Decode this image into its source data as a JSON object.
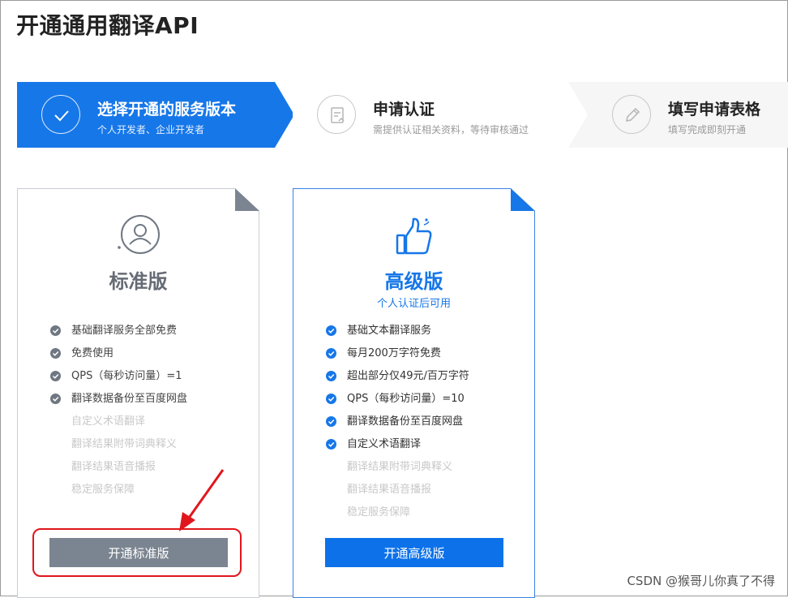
{
  "page": {
    "title": "开通通用翻译API"
  },
  "steps": [
    {
      "title": "选择开通的服务版本",
      "subtitle": "个人开发者、企业开发者",
      "icon": "check-circle-icon",
      "active": true
    },
    {
      "title": "申请认证",
      "subtitle": "需提供认证相关资料，等待审核通过",
      "icon": "document-upload-icon",
      "active": false
    },
    {
      "title": "填写申请表格",
      "subtitle": "填写完成即刻开通",
      "icon": "pencil-icon",
      "active": false
    }
  ],
  "plans": {
    "standard": {
      "name": "标准版",
      "icon": "user-icon",
      "features": [
        {
          "text": "基础翻译服务全部免费",
          "included": true
        },
        {
          "text": "免费使用",
          "included": true
        },
        {
          "text": "QPS（每秒访问量）=1",
          "included": true
        },
        {
          "text": "翻译数据备份至百度网盘",
          "included": true
        },
        {
          "text": "自定义术语翻译",
          "included": false
        },
        {
          "text": "翻译结果附带词典释义",
          "included": false
        },
        {
          "text": "翻译结果语音播报",
          "included": false
        },
        {
          "text": "稳定服务保障",
          "included": false
        }
      ],
      "button_label": "开通标准版"
    },
    "advanced": {
      "name": "高级版",
      "note": "个人认证后可用",
      "icon": "thumbs-up-icon",
      "features": [
        {
          "text": "基础文本翻译服务",
          "included": true
        },
        {
          "text": "每月200万字符免费",
          "included": true
        },
        {
          "text": "超出部分仅49元/百万字符",
          "included": true
        },
        {
          "text": "QPS（每秒访问量）=10",
          "included": true
        },
        {
          "text": "翻译数据备份至百度网盘",
          "included": true
        },
        {
          "text": "自定义术语翻译",
          "included": true
        },
        {
          "text": "翻译结果附带词典释义",
          "included": false
        },
        {
          "text": "翻译结果语音播报",
          "included": false
        },
        {
          "text": "稳定服务保障",
          "included": false
        }
      ],
      "button_label": "开通高级版"
    }
  },
  "watermark": "CSDN @猴哥儿你真了不得",
  "colors": {
    "primary": "#1677e8",
    "standard_gray": "#7b8591",
    "annotation_red": "#e0161c"
  }
}
